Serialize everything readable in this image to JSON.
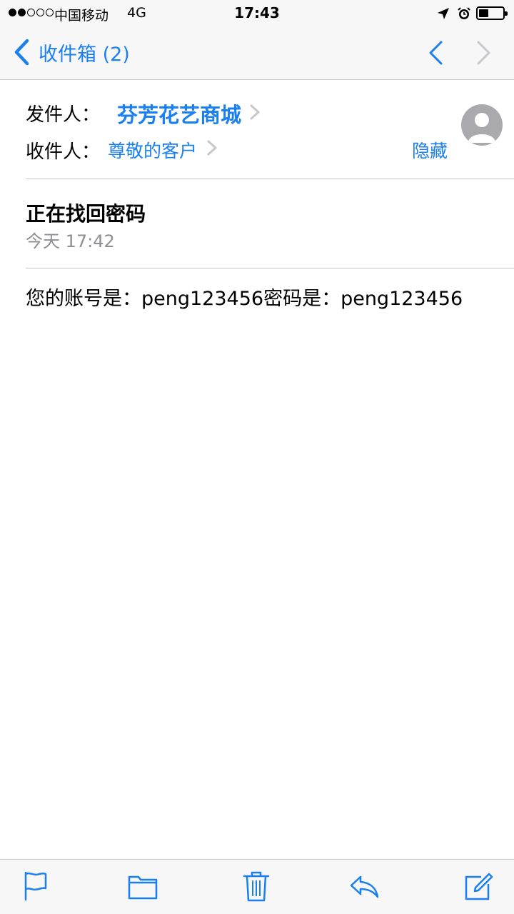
{
  "status_bar": {
    "carrier": "中国移动",
    "network": "4G",
    "time": "17:43",
    "signal_bars_filled": 2,
    "signal_bars_total": 5,
    "icons": [
      "location-arrow-icon",
      "alarm-clock-icon",
      "battery-icon"
    ]
  },
  "nav": {
    "back_label": "收件箱 (2)",
    "prev_icon": "chevron-up-icon",
    "next_icon": "chevron-down-icon"
  },
  "header": {
    "from_label": "发件人：",
    "from_value": "芬芳花艺商城",
    "to_label": "收件人：",
    "to_value": "尊敬的客户",
    "hide_label": "隐藏"
  },
  "message": {
    "subject": "正在找回密码",
    "date": "今天 17:42",
    "body": "您的账号是：peng123456密码是：peng123456"
  },
  "toolbar": {
    "icons": [
      "flag-icon",
      "folder-icon",
      "trash-icon",
      "reply-icon",
      "compose-icon"
    ]
  },
  "colors": {
    "accent": "#1a7ff0",
    "secondary_text": "#8e8e93",
    "separator": "#c8c7cc",
    "bar_background": "#f7f7f7"
  }
}
